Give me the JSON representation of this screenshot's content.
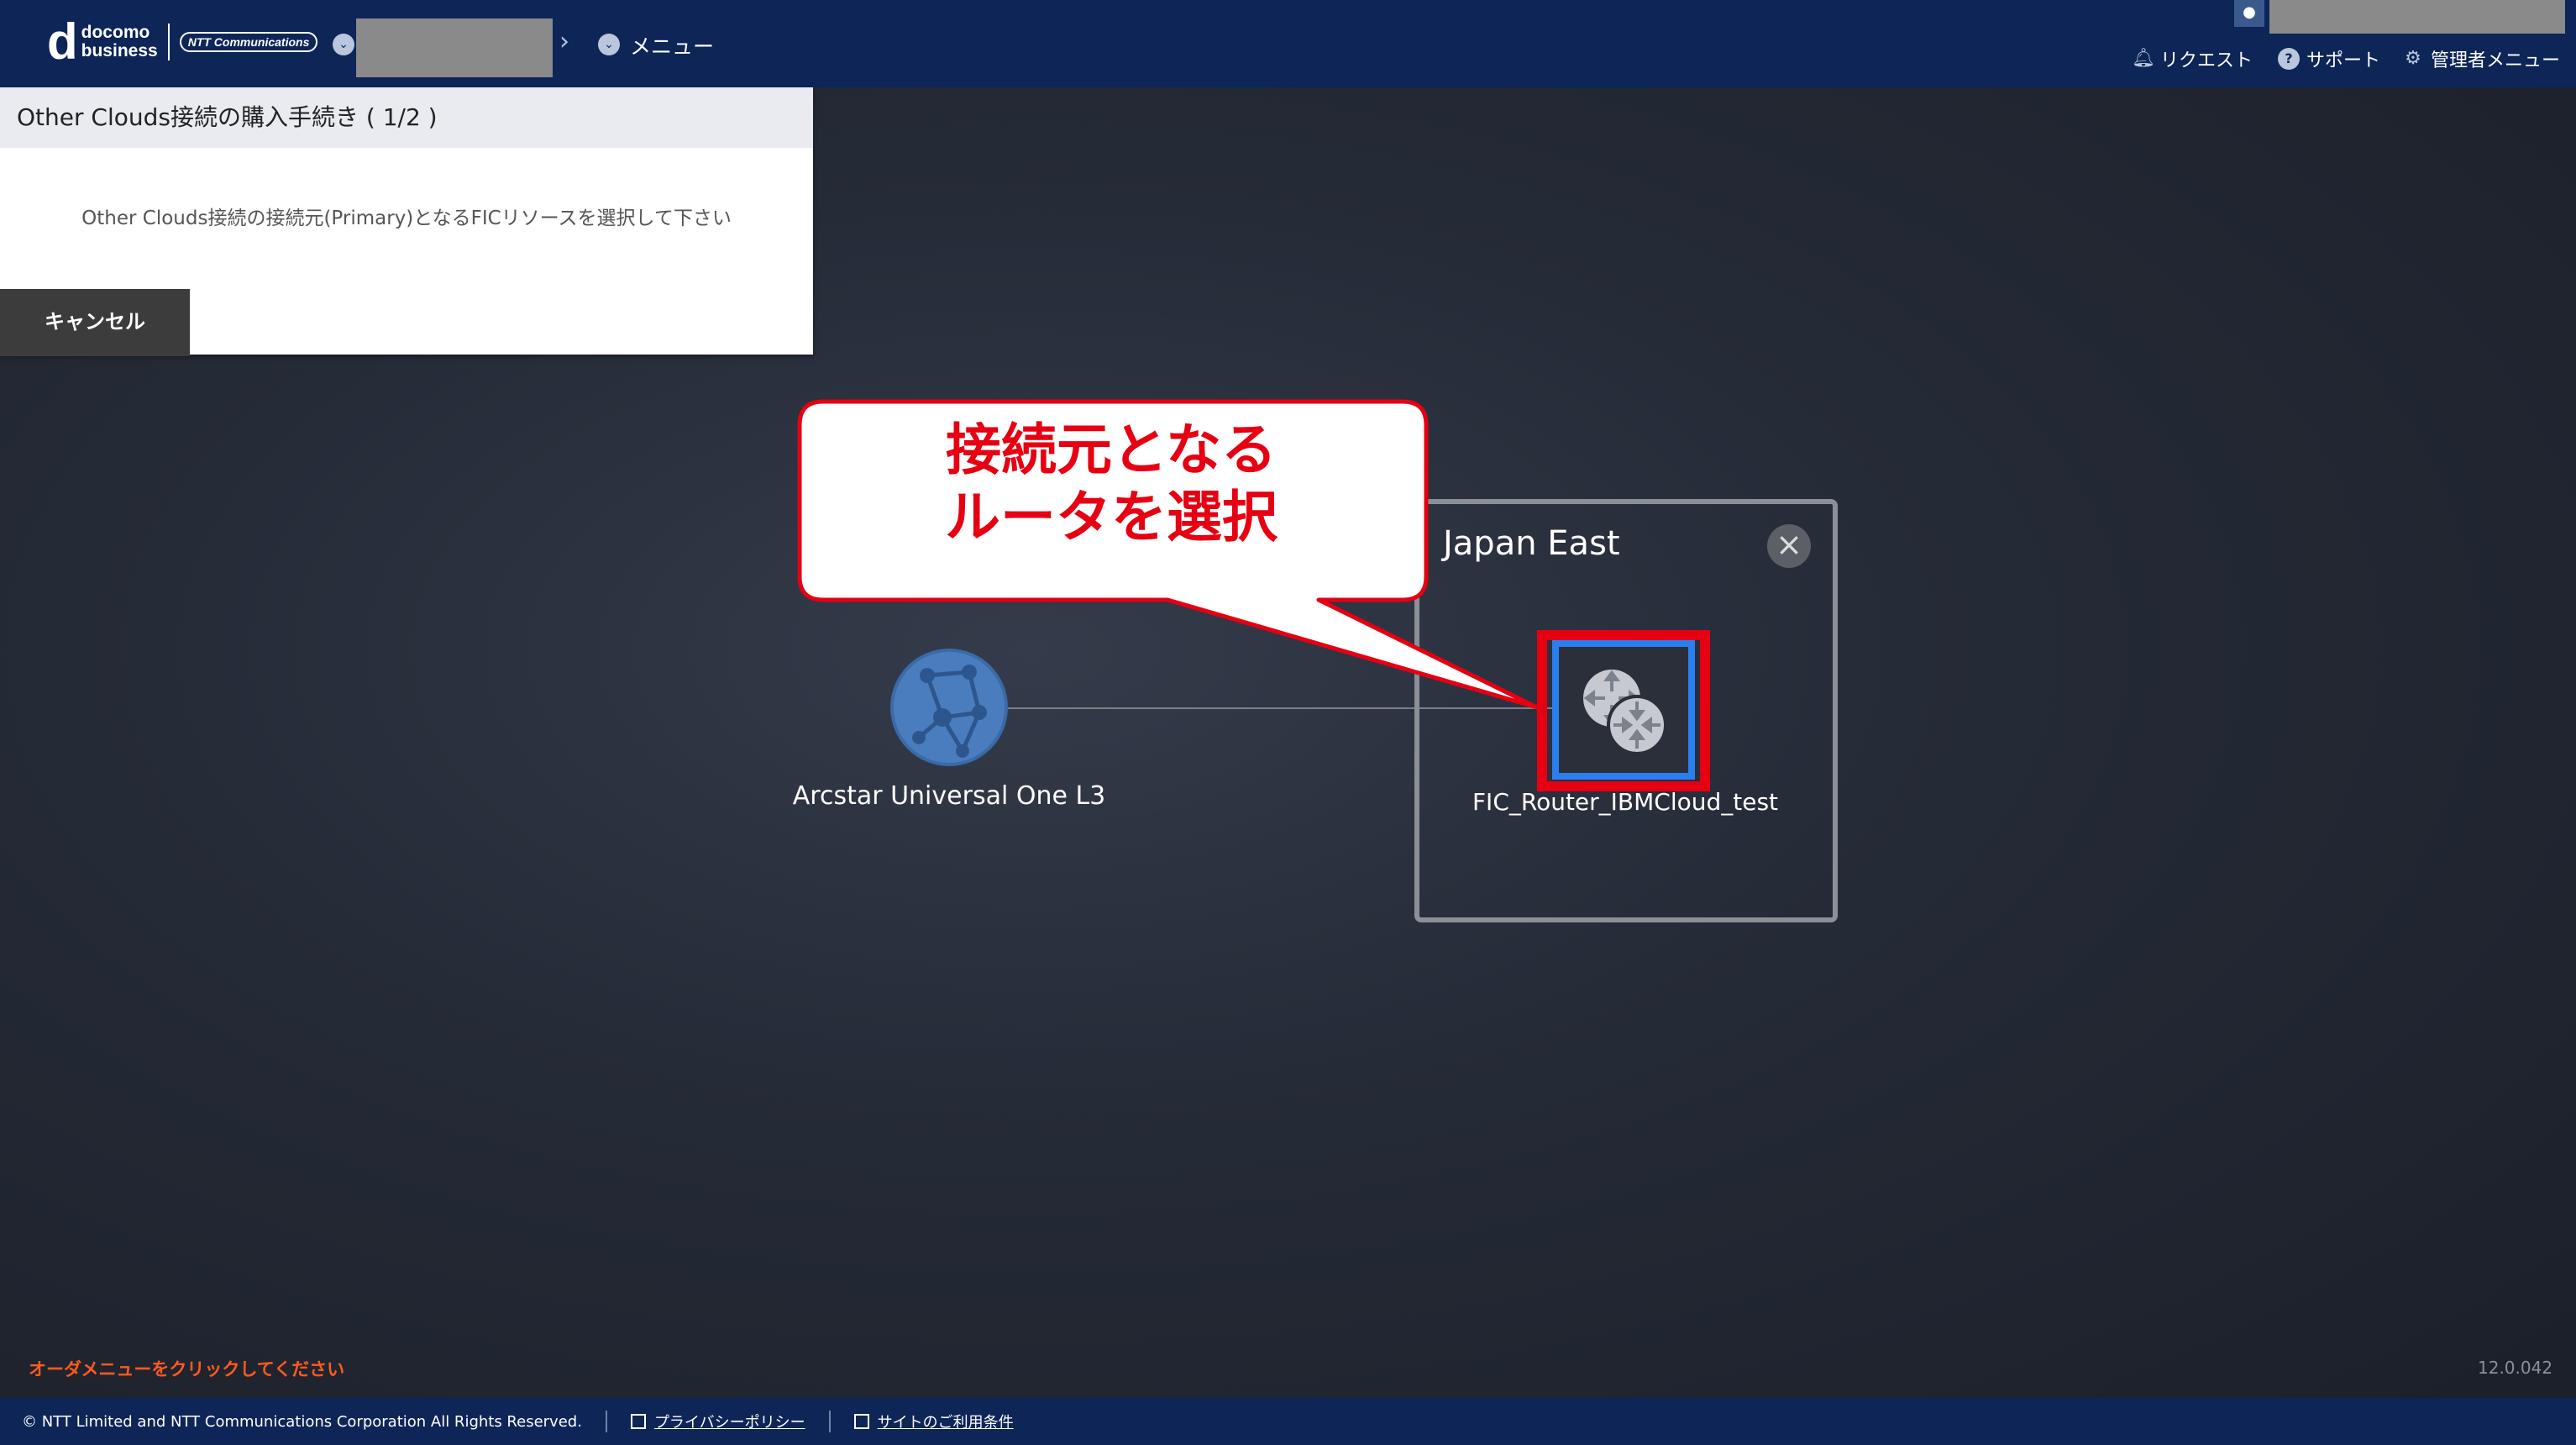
{
  "header": {
    "logo_top": "docomo",
    "logo_bottom": "business",
    "logo_mark": "d",
    "partner_logo": "NTT Communications",
    "menu_label": "メニュー",
    "links": {
      "request": "リクエスト",
      "support": "サポート",
      "admin_menu": "管理者メニュー"
    }
  },
  "panel": {
    "title": "Other Clouds接続の購入手続き ( 1/2 )",
    "message": "Other Clouds接続の接続元(Primary)となるFICリソースを選択して下さい",
    "cancel_label": "キャンセル"
  },
  "diagram": {
    "network_node_label": "Arcstar Universal One L3",
    "region_title": "Japan East",
    "router_label": "FIC_Router_IBMCloud_test"
  },
  "callout": {
    "line1": "接続元となる",
    "line2": "ルータを選択",
    "color": "#e60012"
  },
  "status": {
    "order_hint": "オーダメニューをクリックしてください",
    "version": "12.0.042"
  },
  "footer": {
    "copyright": "© NTT Limited and NTT Communications Corporation All Rights Reserved.",
    "privacy": "プライバシーポリシー",
    "terms": "サイトのご利用条件"
  },
  "icons": {
    "user": "user-icon",
    "bell": "bell-icon",
    "help": "help-icon",
    "gear": "gear-icon",
    "close": "close-icon",
    "globe": "globe-network-icon",
    "router": "router-icon"
  }
}
